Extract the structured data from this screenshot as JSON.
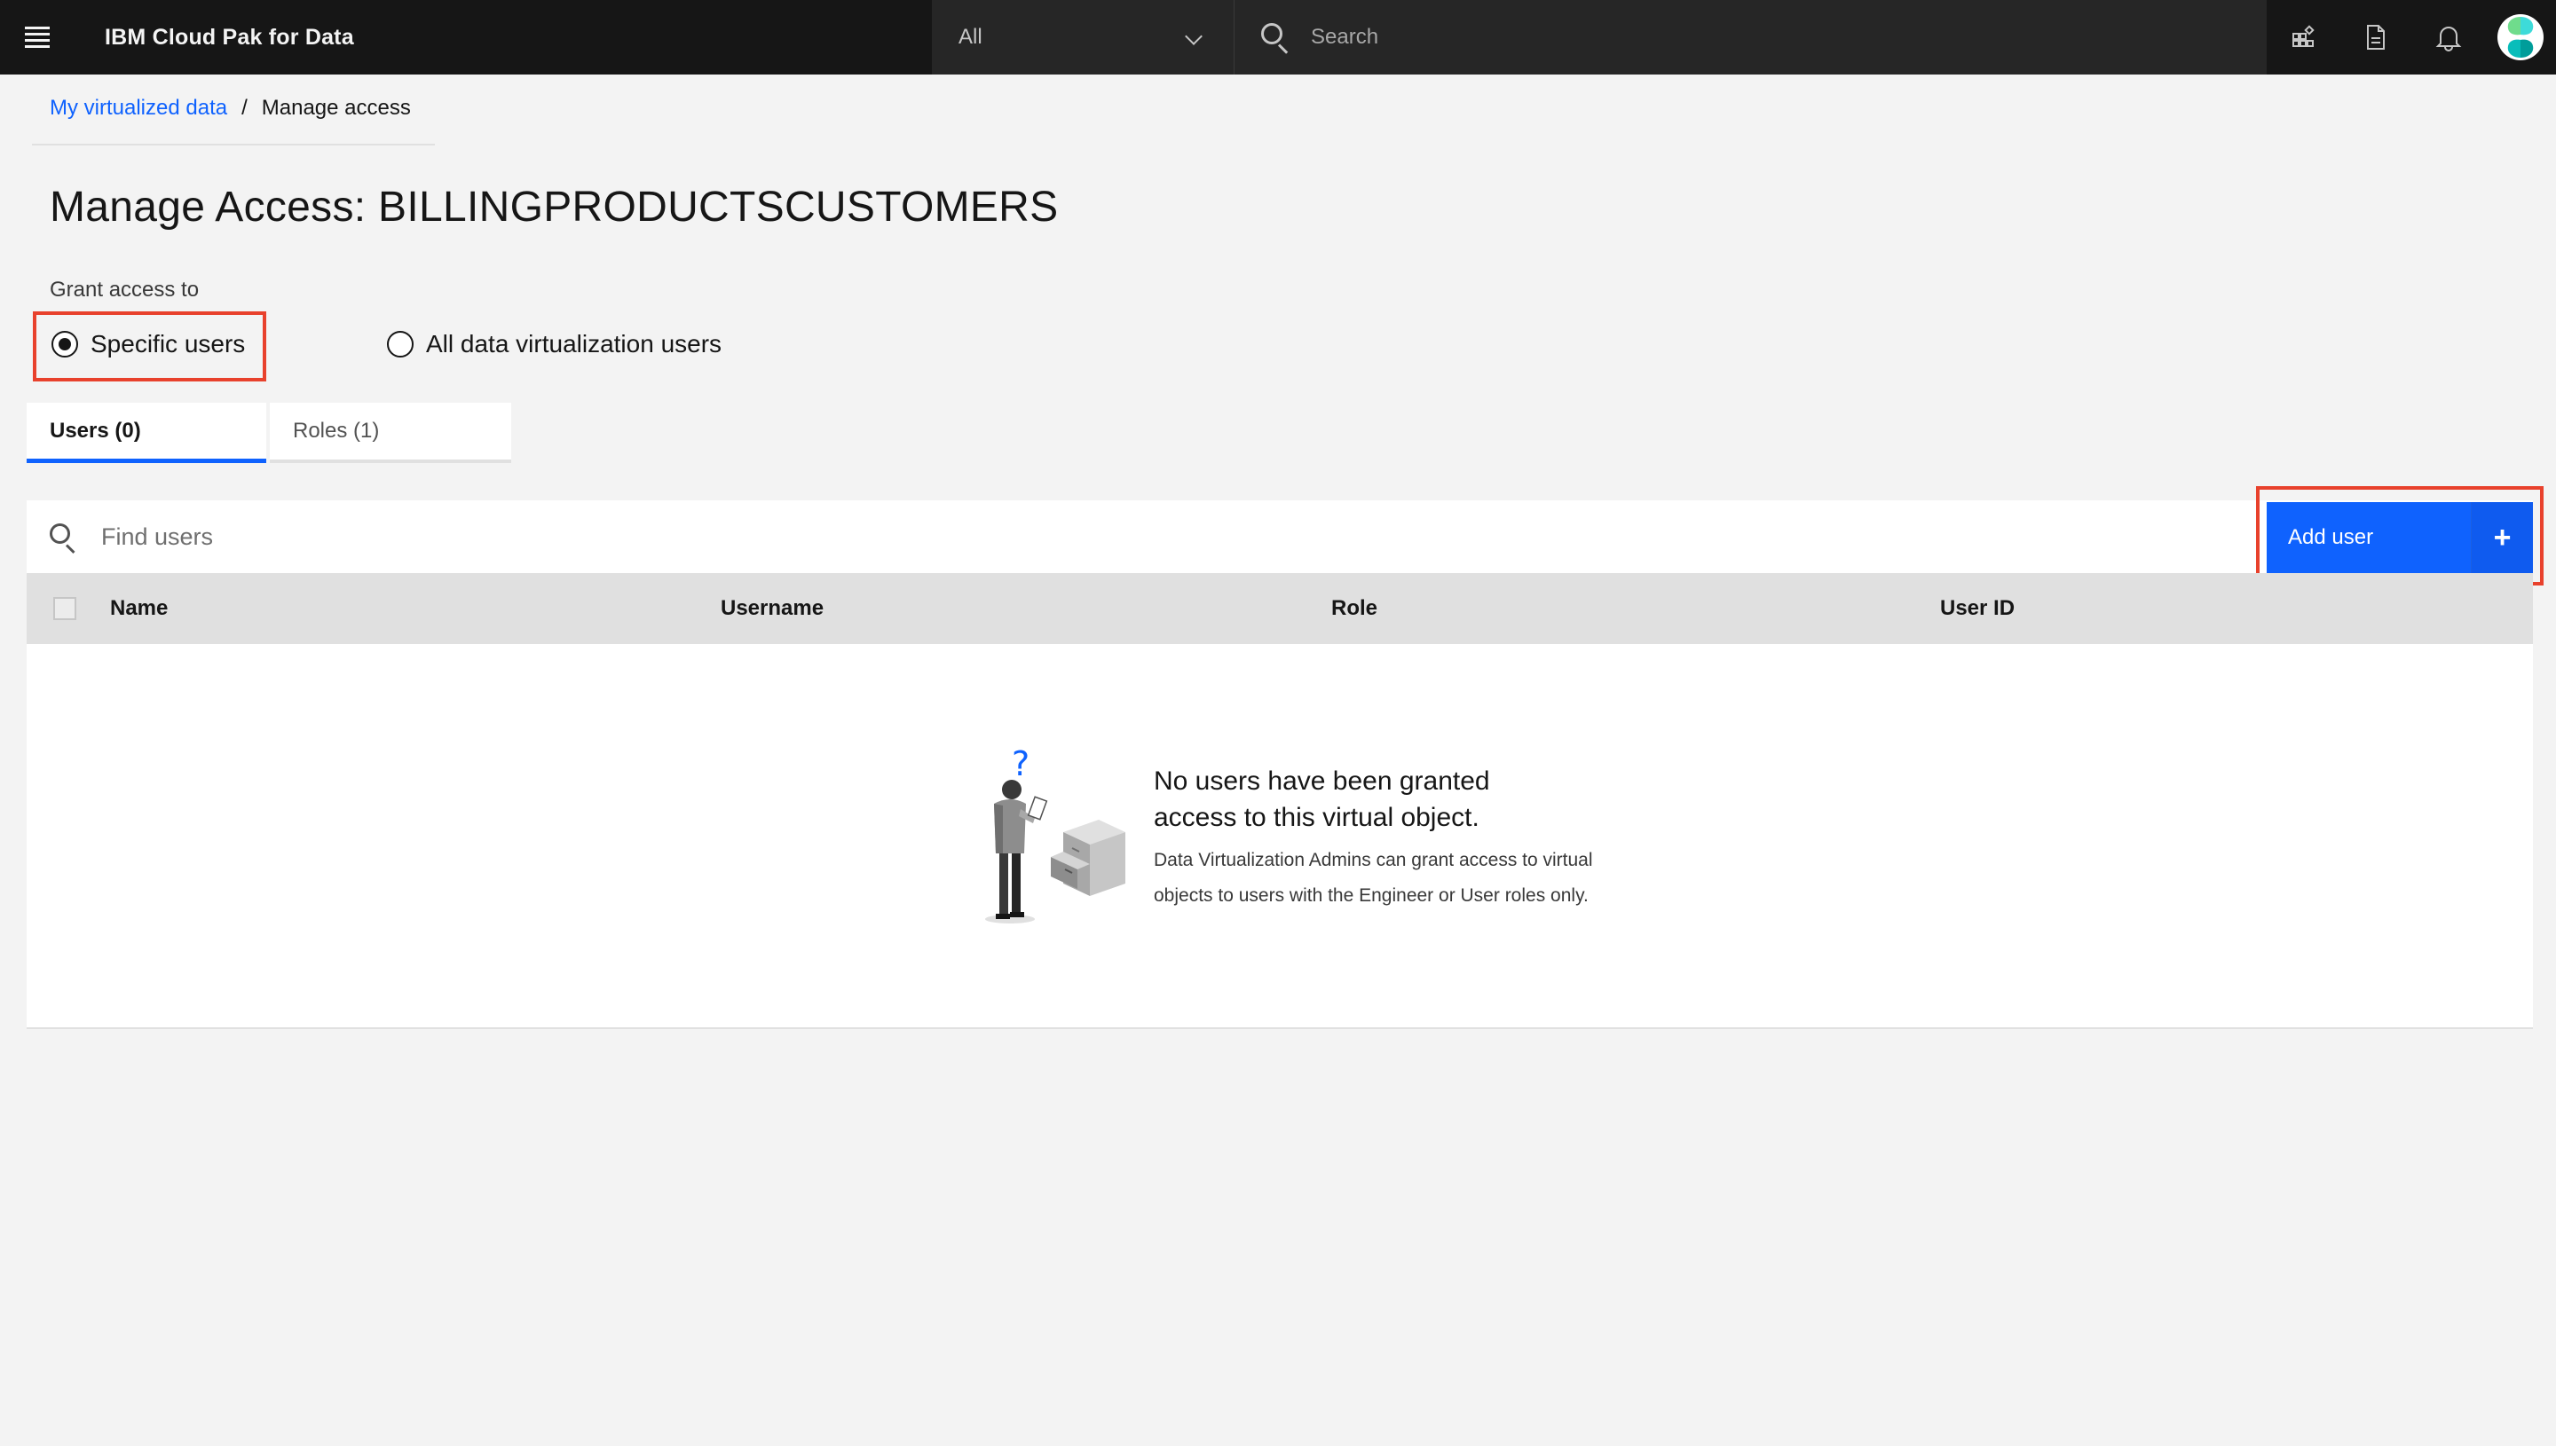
{
  "header": {
    "brand": "IBM Cloud Pak for Data",
    "scope_value": "All",
    "search_placeholder": "Search",
    "icons": [
      "hamburger-menu-icon",
      "apps-grid-icon",
      "document-icon",
      "notification-bell-icon",
      "avatar"
    ]
  },
  "breadcrumb": {
    "parent": "My virtualized data",
    "separator": "/",
    "current": "Manage access"
  },
  "page": {
    "title": "Manage Access: BILLINGPRODUCTSCUSTOMERS",
    "grant_label": "Grant access to",
    "options": [
      {
        "label": "Specific users",
        "selected": true
      },
      {
        "label": "All data virtualization users",
        "selected": false
      }
    ]
  },
  "tabs": [
    {
      "label": "Users (0)",
      "active": true
    },
    {
      "label": "Roles (1)",
      "active": false
    }
  ],
  "toolbar": {
    "find_placeholder": "Find users",
    "add_label": "Add user",
    "add_icon": "+"
  },
  "table": {
    "columns": [
      "Name",
      "Username",
      "Role",
      "User ID"
    ],
    "rows": []
  },
  "empty_state": {
    "title": "No users have been granted access to this virtual object.",
    "description": "Data Virtualization Admins can grant access to virtual objects to users with the Engineer or User roles only."
  },
  "colors": {
    "accent": "#0f62fe",
    "highlight": "#e8412c",
    "header_bg": "#161616"
  }
}
